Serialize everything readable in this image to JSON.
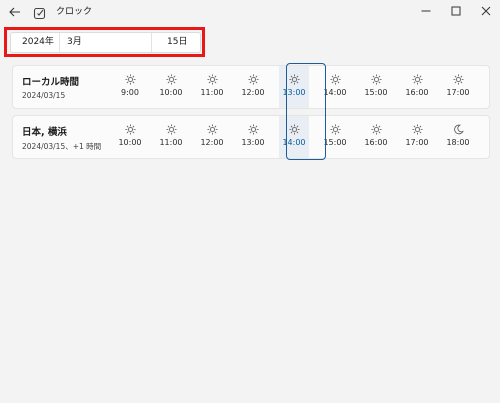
{
  "window": {
    "title": "クロック"
  },
  "date_picker": {
    "year": "2024年",
    "month": "3月",
    "day": "15日"
  },
  "cities": [
    {
      "name": "ローカル時間",
      "subtitle": "2024/03/15",
      "times": [
        "9:00",
        "10:00",
        "11:00",
        "12:00",
        "13:00",
        "14:00",
        "15:00",
        "16:00",
        "17:00"
      ],
      "icons": [
        "sun-icon",
        "sun-icon",
        "sun-icon",
        "sun-icon",
        "sun-icon",
        "sun-icon",
        "sun-icon",
        "sun-icon",
        "sun-icon"
      ]
    },
    {
      "name": "日本, 横浜",
      "subtitle": "2024/03/15、+1 時間",
      "times": [
        "10:00",
        "11:00",
        "12:00",
        "13:00",
        "14:00",
        "15:00",
        "16:00",
        "17:00",
        "18:00"
      ],
      "icons": [
        "sun-icon",
        "sun-icon",
        "sun-icon",
        "sun-icon",
        "sun-icon",
        "sun-icon",
        "sun-icon",
        "sun-icon",
        "moon-icon"
      ]
    }
  ],
  "colors": {
    "accent": "#005a9e",
    "highlight": "#e81818"
  }
}
